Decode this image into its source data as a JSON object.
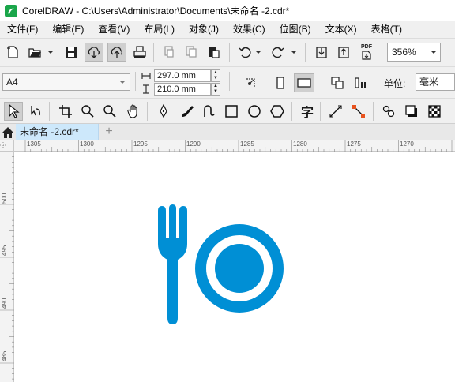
{
  "window": {
    "title": "CorelDRAW - C:\\Users\\Administrator\\Documents\\未命名 -2.cdr*"
  },
  "menu": {
    "items": [
      {
        "label": "文件(F)",
        "name": "menu-file"
      },
      {
        "label": "编辑(E)",
        "name": "menu-edit"
      },
      {
        "label": "查看(V)",
        "name": "menu-view"
      },
      {
        "label": "布局(L)",
        "name": "menu-layout"
      },
      {
        "label": "对象(J)",
        "name": "menu-object"
      },
      {
        "label": "效果(C)",
        "name": "menu-effects"
      },
      {
        "label": "位图(B)",
        "name": "menu-bitmaps"
      },
      {
        "label": "文本(X)",
        "name": "menu-text"
      },
      {
        "label": "表格(T)",
        "name": "menu-table"
      }
    ]
  },
  "standard_toolbar": {
    "zoom_value": "356%",
    "pdf_label": "PDF"
  },
  "property_bar": {
    "page_size": "A4",
    "width_value": "297.0 mm",
    "height_value": "210.0 mm",
    "units_label": "单位:",
    "units_value": "毫米"
  },
  "toolbox": {
    "text_tool_glyph": "字"
  },
  "document_tabs": {
    "active_tab_label": "未命名 -2.cdr*",
    "add_tab_glyph": "+"
  },
  "rulers": {
    "horizontal_labels": [
      "1305",
      "1300",
      "1295",
      "1290",
      "1285",
      "1280",
      "1275",
      "1270"
    ],
    "vertical_labels": [
      "500",
      "495",
      "490",
      "485"
    ]
  },
  "artwork": {
    "fill_color": "#008fd5",
    "background_color": "#ffffff"
  },
  "colors": {
    "menubar_bg": "#f0f0f0",
    "active_tab_bg": "#cde8fb",
    "app_icon_green": "#1aa64a"
  }
}
